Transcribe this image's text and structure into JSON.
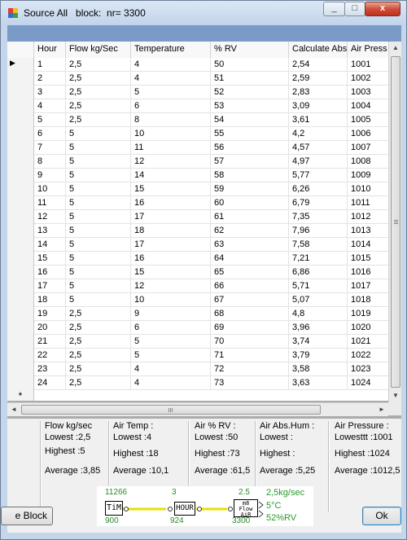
{
  "window": {
    "title": "Source All   block:  nr= 3300",
    "minimize_glyph": "_",
    "maximize_glyph": "□",
    "close_glyph": "x"
  },
  "grid": {
    "columns": [
      "Hour",
      "Flow kg/Sec",
      "Temperature",
      "% RV",
      "Calculate Abs",
      "Air Press"
    ],
    "rows": [
      [
        "1",
        "2,5",
        "4",
        "50",
        "2,54",
        "1001"
      ],
      [
        "2",
        "2,5",
        "4",
        "51",
        "2,59",
        "1002"
      ],
      [
        "3",
        "2,5",
        "5",
        "52",
        "2,83",
        "1003"
      ],
      [
        "4",
        "2,5",
        "6",
        "53",
        "3,09",
        "1004"
      ],
      [
        "5",
        "2,5",
        "8",
        "54",
        "3,61",
        "1005"
      ],
      [
        "6",
        "5",
        "10",
        "55",
        "4,2",
        "1006"
      ],
      [
        "7",
        "5",
        "11",
        "56",
        "4,57",
        "1007"
      ],
      [
        "8",
        "5",
        "12",
        "57",
        "4,97",
        "1008"
      ],
      [
        "9",
        "5",
        "14",
        "58",
        "5,77",
        "1009"
      ],
      [
        "10",
        "5",
        "15",
        "59",
        "6,26",
        "1010"
      ],
      [
        "11",
        "5",
        "16",
        "60",
        "6,79",
        "1011"
      ],
      [
        "12",
        "5",
        "17",
        "61",
        "7,35",
        "1012"
      ],
      [
        "13",
        "5",
        "18",
        "62",
        "7,96",
        "1013"
      ],
      [
        "14",
        "5",
        "17",
        "63",
        "7,58",
        "1014"
      ],
      [
        "15",
        "5",
        "16",
        "64",
        "7,21",
        "1015"
      ],
      [
        "16",
        "5",
        "15",
        "65",
        "6,86",
        "1016"
      ],
      [
        "17",
        "5",
        "12",
        "66",
        "5,71",
        "1017"
      ],
      [
        "18",
        "5",
        "10",
        "67",
        "5,07",
        "1018"
      ],
      [
        "19",
        "2,5",
        "9",
        "68",
        "4,8",
        "1019"
      ],
      [
        "20",
        "2,5",
        "6",
        "69",
        "3,96",
        "1020"
      ],
      [
        "21",
        "2,5",
        "5",
        "70",
        "3,74",
        "1021"
      ],
      [
        "22",
        "2,5",
        "5",
        "71",
        "3,79",
        "1022"
      ],
      [
        "23",
        "2,5",
        "4",
        "72",
        "3,58",
        "1023"
      ],
      [
        "24",
        "2,5",
        "4",
        "73",
        "3,63",
        "1024"
      ]
    ],
    "selected_row_marker": "▶",
    "new_row_marker": "*",
    "vscroll_up": "▲",
    "vscroll_down": "▼",
    "hscroll_left": "◄",
    "hscroll_right": "►"
  },
  "stats": {
    "flow": {
      "title": "Flow kg/sec",
      "lowest": "Lowest :2,5",
      "highest": "Highest :5",
      "average": "Average :3,85"
    },
    "temp": {
      "title": "Air Temp :",
      "lowest": "Lowest :4",
      "highest": "Highest :18",
      "average": "Average :10,1"
    },
    "rv": {
      "title": "Air % RV :",
      "lowest": "Lowest :50",
      "highest": "Highest :73",
      "average": "Average :61,5"
    },
    "abs": {
      "title": "Air Abs.Hum :",
      "lowest": "Lowest :",
      "highest": "Highest :",
      "average": "Average :5,25"
    },
    "pressure": {
      "title": "Air Pressure :",
      "lowest": "Lowesttt :1001",
      "highest": "Highest :1024",
      "average": "Average :1012,5"
    }
  },
  "buttons": {
    "left_label": "e Block",
    "ok_label": "Ok"
  },
  "diagram": {
    "top_left": "11266",
    "top_mid": "3",
    "top_right": "2.5",
    "bottom_left": "900",
    "bottom_mid": "924",
    "bottom_right": "3300",
    "tim_label": "TiM",
    "hour_label": "HOUR",
    "air_box_label": "m8 Flow AiR",
    "out_flow": "2,5kg/sec",
    "out_temp": "5°C",
    "out_rv": "52%RV"
  }
}
